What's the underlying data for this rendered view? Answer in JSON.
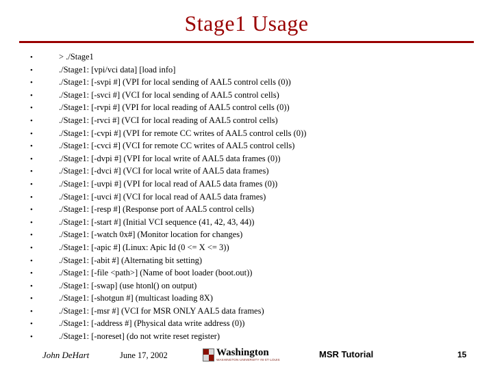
{
  "slide": {
    "title": "Stage1 Usage",
    "bullet_mark": "•",
    "bullets": [
      "> ./Stage1",
      "./Stage1: [vpi/vci data] [load info]",
      "./Stage1: [-svpi #] (VPI for local sending of AAL5 control cells (0))",
      "./Stage1: [-svci #] (VCI for local sending of AAL5 control cells)",
      "./Stage1: [-rvpi #] (VPI for local reading of AAL5 control cells (0))",
      "./Stage1: [-rvci #] (VCI for local reading of AAL5 control cells)",
      "./Stage1: [-cvpi #] (VPI for remote CC writes of AAL5 control cells (0))",
      "./Stage1: [-cvci #] (VCI for remote CC writes of AAL5 control cells)",
      "./Stage1: [-dvpi #] (VPI for local write of AAL5 data frames (0))",
      "./Stage1: [-dvci #] (VCI for local write of AAL5 data frames)",
      "./Stage1: [-uvpi #] (VPI for local read of AAL5 data frames (0))",
      "./Stage1: [-uvci #] (VCI for local read of AAL5 data frames)",
      "./Stage1: [-resp #] (Response port of AAL5 control cells)",
      "./Stage1: [-start #] (Initial VCI sequence (41, 42, 43, 44))",
      "./Stage1: [-watch 0x#] (Monitor location for changes)",
      "./Stage1: [-apic #] (Linux: Apic Id (0 <= X <= 3))",
      "./Stage1: [-abit #] (Alternating bit setting)",
      "./Stage1: [-file <path>] (Name of boot loader (boot.out))",
      "./Stage1: [-swap] (use htonl() on output)",
      "./Stage1: [-shotgun #] (multicast loading 8X)",
      "./Stage1: [-msr #] (VCI for MSR ONLY AAL5 data frames)",
      "./Stage1: [-address #] (Physical data write address (0))",
      "./Stage1: [-noreset] (do not write reset register)"
    ]
  },
  "footer": {
    "author": "John DeHart",
    "date": "June 17, 2002",
    "logo_name": "Washington",
    "logo_sub": "WASHINGTON·UNIVERSITY·IN·ST·LOUIS",
    "center": "MSR Tutorial",
    "page": "15"
  },
  "colors": {
    "title": "#990000",
    "rule": "#990000",
    "text": "#000000"
  }
}
